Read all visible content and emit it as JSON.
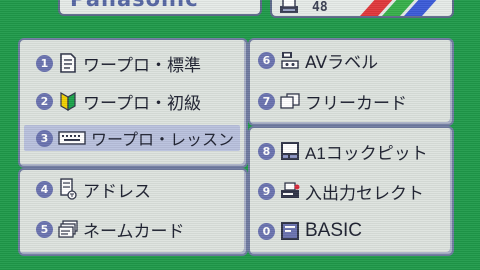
{
  "header": {
    "brand": "Panasonic",
    "count": "48",
    "stripe_colors": [
      "#e0383b",
      "#37b04a",
      "#3b5bd8"
    ]
  },
  "menu": [
    {
      "num": "1",
      "label": "ワープロ・標準",
      "icon": "document-icon"
    },
    {
      "num": "2",
      "label": "ワープロ・初級",
      "icon": "beginner-mark-icon"
    },
    {
      "num": "3",
      "label": "ワープロ・レッスン",
      "icon": "keyboard-icon",
      "selected": true
    },
    {
      "num": "4",
      "label": "アドレス",
      "icon": "address-book-icon"
    },
    {
      "num": "5",
      "label": "ネームカード",
      "icon": "name-cards-icon"
    },
    {
      "num": "6",
      "label": "AVラベル",
      "icon": "av-label-icon"
    },
    {
      "num": "7",
      "label": "フリーカード",
      "icon": "free-cards-icon"
    },
    {
      "num": "8",
      "label": "A1コックピット",
      "icon": "cockpit-computer-icon"
    },
    {
      "num": "9",
      "label": "入出力セレクト",
      "icon": "io-printer-icon"
    },
    {
      "num": "0",
      "label": "BASIC",
      "icon": "basic-computer-icon"
    }
  ],
  "colors": {
    "background": "#1f9a4a",
    "panel": "#dde3de",
    "border": "#6f7aa0",
    "number_badge": "#6a73b0",
    "selection": "#b9c1dd"
  }
}
